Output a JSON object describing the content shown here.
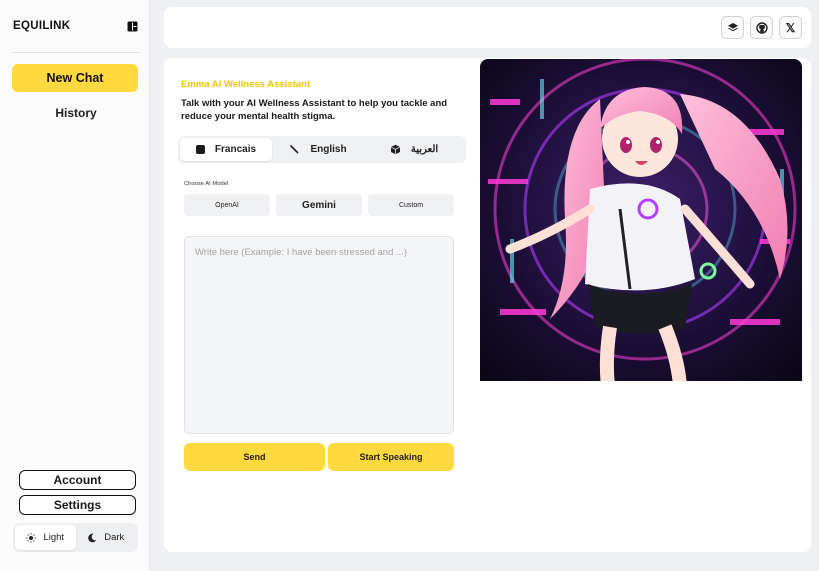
{
  "sidebar": {
    "logo": "EQUILINK",
    "new_chat_label": "New Chat",
    "history_label": "History",
    "account_label": "Account",
    "settings_label": "Settings",
    "theme": {
      "light_label": "Light",
      "dark_label": "Dark",
      "selected": "Light"
    }
  },
  "header": {
    "icons": [
      "layers-icon",
      "github-icon",
      "x-twitter-icon"
    ],
    "x_glyph": "𝕏"
  },
  "main": {
    "assistant_name": "Emma AI Wellness Assistant",
    "subtitle": "Talk with your AI Wellness Assistant to help you tackle and reduce your mental health stigma.",
    "languages": [
      {
        "label": "Francais",
        "icon": "square-icon",
        "active": true
      },
      {
        "label": "English",
        "icon": "magic-wand-icon",
        "active": false
      },
      {
        "label": "العربية",
        "icon": "cube-icon",
        "active": false
      }
    ],
    "model_label": "Choose AI Model",
    "models": [
      "OpenAI",
      "Gemini",
      "Custom"
    ],
    "input_placeholder": "Write here (Example: I have been stressed and ...)",
    "send_label": "Send",
    "speak_label": "Start Speaking"
  },
  "colors": {
    "accent": "#ffd93d",
    "title_yellow": "#f5c400",
    "background": "#eef0f3",
    "card": "#ffffff"
  }
}
